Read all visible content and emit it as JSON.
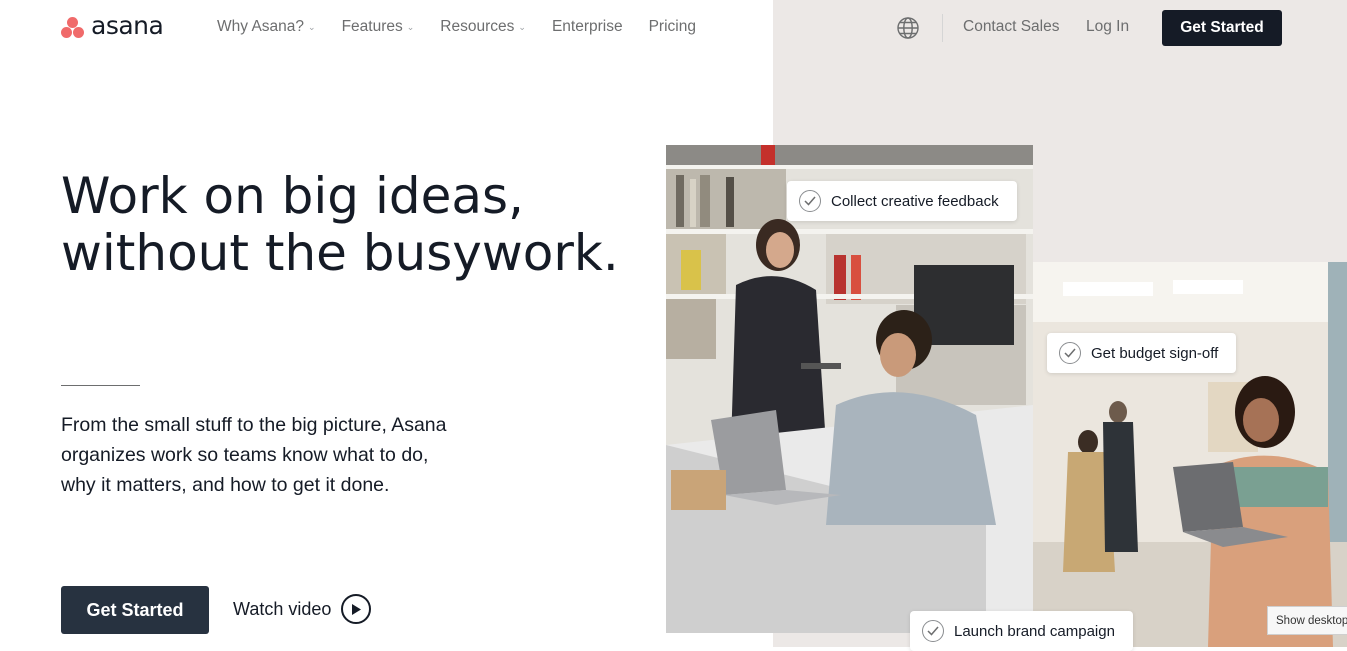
{
  "brand": {
    "name": "asana",
    "logo_color": "#f06a6a"
  },
  "nav": {
    "items": [
      {
        "label": "Why Asana?",
        "has_dropdown": true
      },
      {
        "label": "Features",
        "has_dropdown": true
      },
      {
        "label": "Resources",
        "has_dropdown": true
      },
      {
        "label": "Enterprise",
        "has_dropdown": false
      },
      {
        "label": "Pricing",
        "has_dropdown": false
      }
    ],
    "globe_icon": "globe-icon",
    "contact_label": "Contact Sales",
    "login_label": "Log In",
    "cta_label": "Get Started"
  },
  "hero": {
    "title_line1": "Work on big ideas,",
    "title_line2": "without the busywork.",
    "description": "From the small stuff to the big picture, Asana organizes work so teams know what to do, why it matters, and how to get it done.",
    "primary_cta": "Get Started",
    "watch_label": "Watch video"
  },
  "cards": {
    "card1": "Collect creative feedback",
    "card2": "Get budget sign-off",
    "card3": "Launch brand campaign"
  },
  "tooltip": "Show desktop",
  "colors": {
    "dark": "#151b26",
    "button_dark": "#273240",
    "muted": "#6d6e6f",
    "panel": "#ece8e6"
  }
}
